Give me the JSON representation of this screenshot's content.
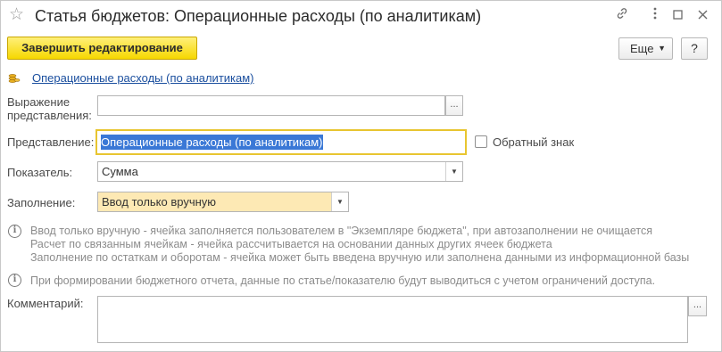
{
  "window": {
    "title": "Статья бюджетов: Операционные расходы (по аналитикам)",
    "icons": [
      "star-icon",
      "link-icon",
      "more-vertical-icon",
      "minimize-icon",
      "maximize-icon",
      "close-icon"
    ]
  },
  "toolbar": {
    "finish_label": "Завершить редактирование",
    "more_label": "Еще",
    "help_label": "?"
  },
  "link_row": {
    "text": "Операционные расходы (по аналитикам)",
    "icon": "coins-icon"
  },
  "form": {
    "expression": {
      "label_line1": "Выражение",
      "label_line2": "представления:",
      "value": "",
      "button": "..."
    },
    "representation": {
      "label": "Представление:",
      "value": "Операционные расходы (по аналитикам)"
    },
    "reverse_sign": {
      "label": "Обратный знак",
      "checked": false
    },
    "indicator": {
      "label": "Показатель:",
      "value": "Сумма"
    },
    "filling": {
      "label": "Заполнение:",
      "value": "Ввод только вручную"
    },
    "comment": {
      "label": "Комментарий:",
      "value": "",
      "button": "..."
    }
  },
  "info": {
    "lines": [
      "Ввод только вручную - ячейка заполняется пользователем в \"Экземпляре бюджета\", при автозаполнении не очищается",
      "Расчет по связанным ячейкам - ячейка рассчитывается на основании данных других ячеек бюджета",
      "Заполнение по остаткам и оборотам - ячейка может быть введена вручную или заполнена данными из информационной базы"
    ],
    "access_note": "При формировании бюджетного отчета, данные по статье/показателю будут выводиться с учетом ограничений доступа."
  },
  "colors": {
    "primary_button": "#f6d800",
    "link": "#1a4e9e",
    "focus_border": "#e8c530",
    "selection": "#3a78d6",
    "filling_bg": "#fde9b4"
  }
}
